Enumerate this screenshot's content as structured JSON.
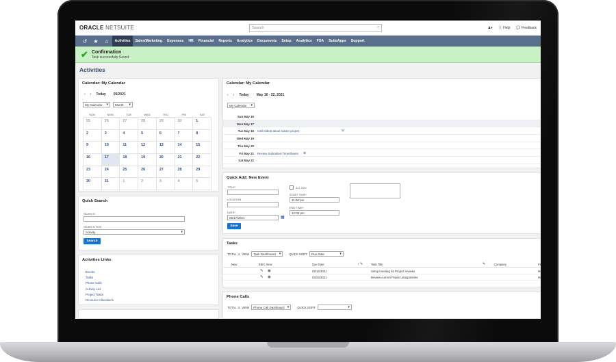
{
  "header": {
    "logo_main": "ORACLE",
    "logo_sub": "NETSUITE",
    "search_placeholder": "Search",
    "help_label": "Help",
    "feedback_label": "Feedback"
  },
  "nav": {
    "items": [
      "Activities",
      "Sales/Marketing",
      "Expenses",
      "HR",
      "Financial",
      "Reports",
      "Analytics",
      "Documents",
      "Setup",
      "Analytics",
      "FSA",
      "SuiteApps",
      "Support"
    ],
    "active_index": 0
  },
  "confirmation": {
    "title": "Confirmation",
    "message": "Task successfully Saved"
  },
  "page_title": "Activities",
  "month_calendar": {
    "title": "Calendar: My Calendar",
    "today_label": "Today",
    "period": "05/2021",
    "calendar_select": "My Calendar",
    "view_select": "Month",
    "weekdays": [
      "SUN",
      "MON",
      "TUE",
      "WED",
      "THU",
      "FRI",
      "SAT"
    ],
    "weeks": [
      [
        "25",
        "26",
        "27",
        "28",
        "29",
        "30",
        "1"
      ],
      [
        "2",
        "3",
        "4",
        "5",
        "6",
        "7",
        "8"
      ],
      [
        "9",
        "10",
        "11",
        "12",
        "13",
        "14",
        "15"
      ],
      [
        "16",
        "17",
        "18",
        "19",
        "20",
        "21",
        "22"
      ],
      [
        "23",
        "24",
        "25",
        "26",
        "27",
        "28",
        "29"
      ],
      [
        "30",
        "31",
        "1",
        "2",
        "3",
        "4",
        "5"
      ]
    ],
    "other_month": [
      [
        0,
        1,
        2,
        3,
        4,
        5
      ],
      [],
      [],
      [],
      [],
      [
        2,
        3,
        4,
        5,
        6
      ]
    ],
    "today": [
      3,
      1
    ]
  },
  "week_calendar": {
    "title": "Calendar: My Calendar",
    "today_label": "Today",
    "period": "May 16 - 22, 2021",
    "calendar_select": "My Calendar",
    "days": [
      {
        "label": "Sun May 16",
        "event": ""
      },
      {
        "label": "Mon May 17",
        "event": ""
      },
      {
        "label": "Tue May 18",
        "event": "Call Abbott about starter project"
      },
      {
        "label": "Wed May 19",
        "event": ""
      },
      {
        "label": "Thu May 20",
        "event": ""
      },
      {
        "label": "Fri May 21",
        "event": "Review Submitted TimeSheets"
      },
      {
        "label": "Sat May 22",
        "event": ""
      }
    ]
  },
  "quick_search": {
    "title": "Quick Search",
    "search_label": "SEARCH",
    "search_for_label": "SEARCH FOR",
    "search_for_value": "Activity",
    "button": "Search"
  },
  "activities_links": {
    "title": "Activities Links",
    "links": [
      "Events",
      "Tasks",
      "Phone Calls",
      "Activity List",
      "Project Tasks",
      "Resource Allocations"
    ]
  },
  "quick_add": {
    "title": "Quick Add: New Event",
    "title_label": "TITLE*",
    "location_label": "LOCATION",
    "date_label": "DATE*",
    "date_value": "05/17/2021",
    "all_day_label": "ALL DAY",
    "start_label": "START TIME*",
    "start_value": "11:00 pm",
    "end_label": "END TIME*",
    "end_value": "12:00 pm",
    "button": "Save"
  },
  "tasks": {
    "title": "Tasks",
    "total": "TOTAL: 2",
    "view_label": "VIEW",
    "view_value": "Task Dashboard",
    "sort_label": "QUICK SORT",
    "sort_value": "Due Date",
    "columns": [
      "New",
      "Edit | View",
      "Due Date",
      "Task Title",
      "Company",
      "Pr"
    ],
    "rows": [
      {
        "due": "03/14/2021",
        "title": "Setup meeting for Project reviews",
        "extra": "Me"
      },
      {
        "due": "03/24/2021",
        "title": "Review current Project assignments",
        "extra": "Hig"
      }
    ]
  },
  "phone_calls": {
    "title": "Phone Calls",
    "total": "TOTAL: 2",
    "view_label": "VIEW",
    "view_value": "Phone Call Dashboard",
    "sort_label": "QUICK SORT",
    "sort_value": ""
  }
}
